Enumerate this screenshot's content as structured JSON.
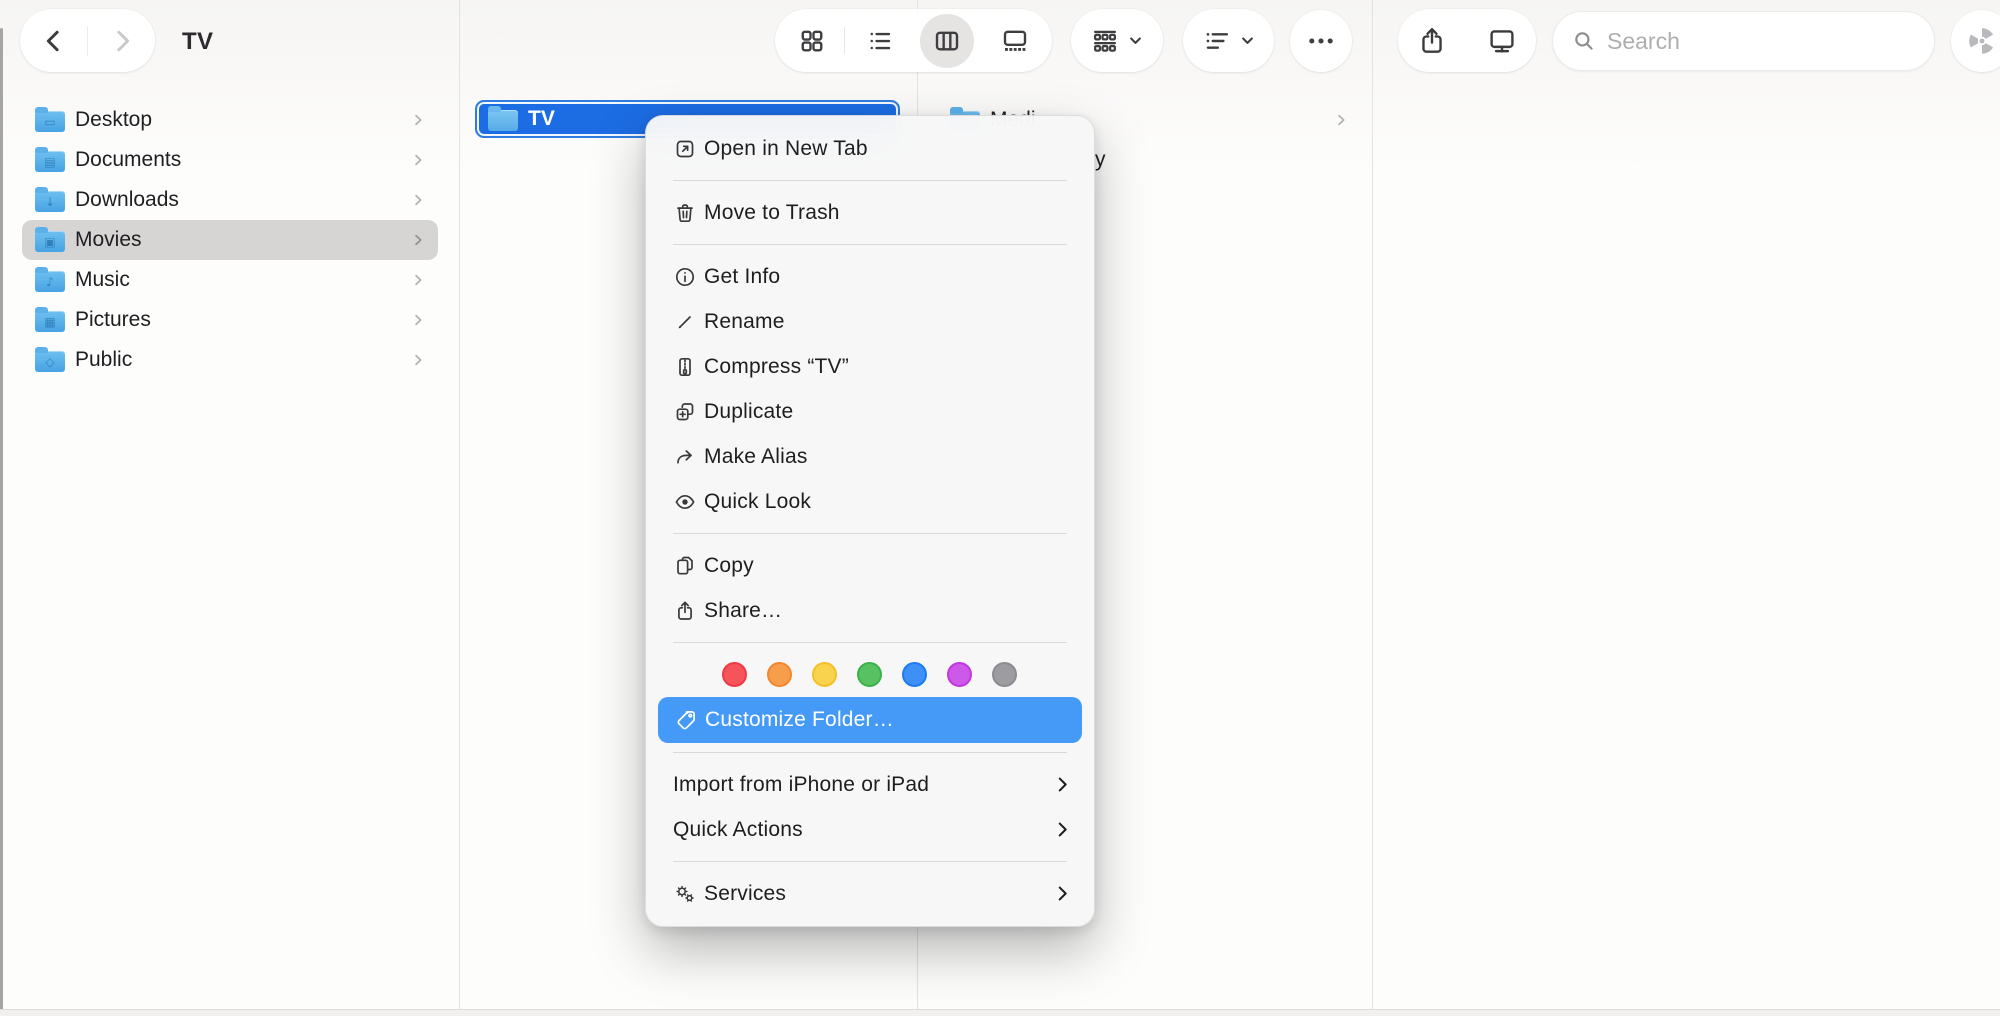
{
  "theme": {
    "selection_blue": "#1c6ce3",
    "menu_highlight": "#459af8",
    "folder_top": "#6fc0f1",
    "folder_bottom": "#47a3e3",
    "folder_tab": "#5cb1ea"
  },
  "toolbar": {
    "title": "TV",
    "search_placeholder": "Search"
  },
  "columns": {
    "home": {
      "items": [
        {
          "label": "Desktop",
          "glyph": "▭"
        },
        {
          "label": "Documents",
          "glyph": "▤"
        },
        {
          "label": "Downloads",
          "glyph": "↓"
        },
        {
          "label": "Movies",
          "glyph": "▣",
          "selected": "true"
        },
        {
          "label": "Music",
          "glyph": "♪"
        },
        {
          "label": "Pictures",
          "glyph": "▦"
        },
        {
          "label": "Public",
          "glyph": "◇"
        }
      ]
    },
    "movies": {
      "items": [
        {
          "label": "TV",
          "selected": "true"
        }
      ]
    },
    "tv": {
      "items": [
        {
          "label": "Medi"
        },
        {
          "label": "y"
        }
      ]
    }
  },
  "context_menu": {
    "items": {
      "open_in_new_tab": "Open in New Tab",
      "move_to_trash": "Move to Trash",
      "get_info": "Get Info",
      "rename": "Rename",
      "compress": "Compress “TV”",
      "duplicate": "Duplicate",
      "make_alias": "Make Alias",
      "quick_look": "Quick Look",
      "copy": "Copy",
      "share": "Share…",
      "customize_folder": "Customize Folder…",
      "import_from_iphone": "Import from iPhone or iPad",
      "quick_actions": "Quick Actions",
      "services": "Services"
    },
    "tags": [
      {
        "name": "red",
        "fill": "#f6535b",
        "ring": "#ee3a44"
      },
      {
        "name": "orange",
        "fill": "#f79e4d",
        "ring": "#f2862e"
      },
      {
        "name": "yellow",
        "fill": "#f9d34d",
        "ring": "#f2c128"
      },
      {
        "name": "green",
        "fill": "#58c262",
        "ring": "#3cb14c"
      },
      {
        "name": "blue",
        "fill": "#3e90f7",
        "ring": "#1d7cf0"
      },
      {
        "name": "purple",
        "fill": "#ce58e8",
        "ring": "#c138e0"
      },
      {
        "name": "gray",
        "fill": "#9c9ca1",
        "ring": "#8b8b90"
      }
    ]
  }
}
